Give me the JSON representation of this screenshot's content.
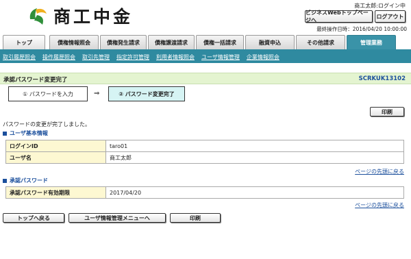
{
  "header": {
    "logo_text": "商工中金",
    "user": "商工太郎:ログイン中",
    "biz_top_button": "ビジネスWebトップページへ",
    "logout_button": "ログアウト",
    "last_operation": "最終操作日時：2016/04/20 10:00:00"
  },
  "tabs": [
    "トップ",
    "債権情報照会",
    "債権発生請求",
    "債権譲渡請求",
    "債権一括請求",
    "融資申込",
    "その他請求",
    "管理業務"
  ],
  "subnav": [
    "取引履歴照会",
    "操作履歴照会",
    "取引先管理",
    "指定許可管理",
    "利用者情報照会",
    "ユーザ情報管理",
    "企業情報照会"
  ],
  "page": {
    "title": "承認パスワード変更完了",
    "screen_id": "SCRKUK13102"
  },
  "steps": {
    "step1": "① パスワードを入力",
    "arrow": "⇒",
    "step2": "② パスワード変更完了"
  },
  "print_label": "印刷",
  "message": "パスワードの変更が完了しました。",
  "user_info": {
    "heading": "ユーザ基本情報",
    "rows": [
      {
        "label": "ログインID",
        "value": "taro01"
      },
      {
        "label": "ユーザ名",
        "value": "商工太郎"
      }
    ]
  },
  "approval": {
    "heading": "承認パスワード",
    "rows": [
      {
        "label": "承認パスワード有効期限",
        "value": "2017/04/20"
      }
    ]
  },
  "to_top_link": "ページの先頭に戻る",
  "footer_buttons": {
    "back": "トップへ戻る",
    "user_menu": "ユーザ情報管理メニューへ",
    "print": "印刷"
  },
  "colors": {
    "accent": "#2f8aa0",
    "title_bar": "#e4f4d0",
    "label_cell": "#fdf8d2",
    "link": "#1b4f9c"
  }
}
